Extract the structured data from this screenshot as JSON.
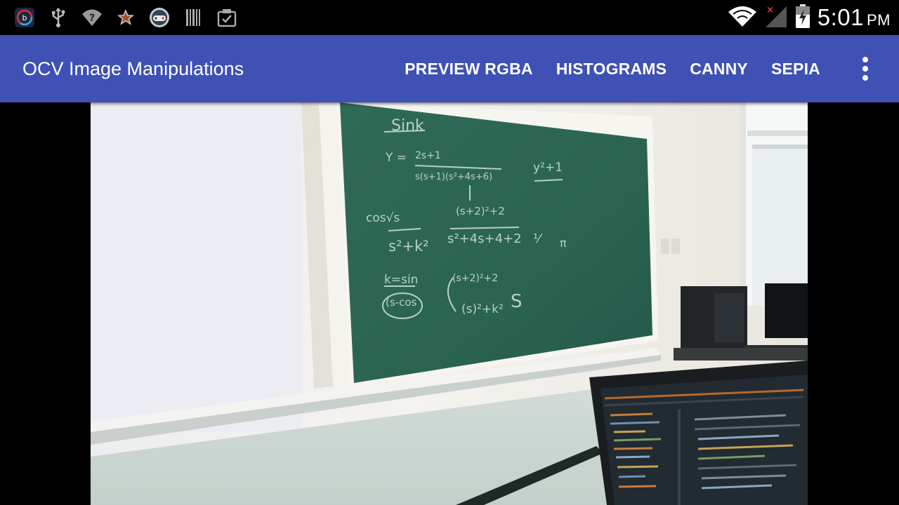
{
  "status_bar": {
    "left_icons": [
      "app-notification-icon",
      "usb-icon",
      "wifi-unknown-icon",
      "star-icon",
      "game-controller-icon",
      "barcode-icon",
      "clipboard-check-icon"
    ],
    "right_icons": [
      "wifi-icon",
      "no-signal-icon",
      "battery-charging-icon"
    ],
    "time": "5:01",
    "ampm": "PM"
  },
  "action_bar": {
    "title": "OCV Image Manipulations",
    "actions": [
      "PREVIEW RGBA",
      "HISTOGRAMS",
      "CANNY",
      "SEPIA"
    ],
    "overflow_icon": "more-vert-icon",
    "color": "#3f51b5"
  },
  "camera_preview": {
    "description_icon": "camera-frame",
    "chalkboard_text": [
      "Sink",
      "Y =",
      "2s+1",
      "s(s+1)(s²+4s+6)",
      "y²+1",
      "cos√s",
      "(s+2)²+2",
      "s²+k²",
      "s²+4s+4+2",
      "k=sin",
      "(s+2)²+2",
      "S",
      "(s)²+k²",
      "s-cos"
    ]
  }
}
